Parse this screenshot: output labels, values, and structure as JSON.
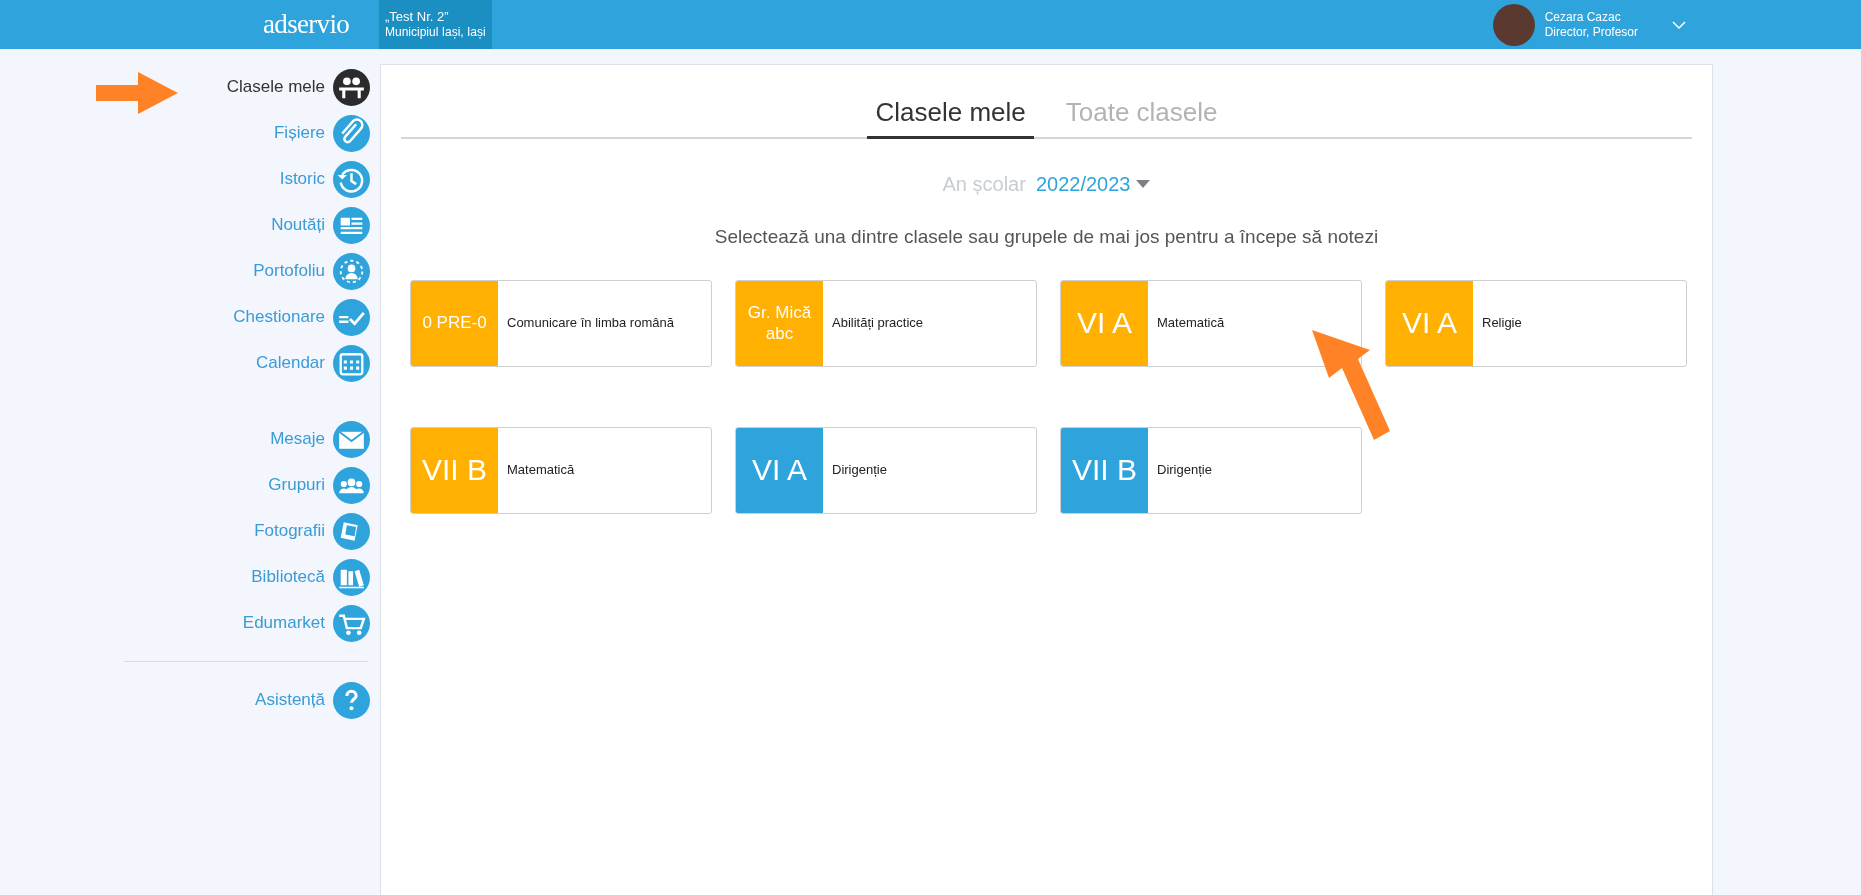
{
  "header": {
    "logo": "adservio",
    "school": {
      "name": "„Test Nr. 2”",
      "location": "Municipiul Iași, Iași"
    },
    "user": {
      "name": "Cezara Cazac",
      "role": "Director, Profesor"
    }
  },
  "sidebar": {
    "groups": [
      [
        {
          "label": "Clasele mele",
          "kind": "classes",
          "selected": true
        },
        {
          "label": "Fișiere",
          "kind": "clip",
          "selected": false
        },
        {
          "label": "Istoric",
          "kind": "history",
          "selected": false
        },
        {
          "label": "Noutăți",
          "kind": "news",
          "selected": false
        },
        {
          "label": "Portofoliu",
          "kind": "portfolio",
          "selected": false
        },
        {
          "label": "Chestionare",
          "kind": "quiz",
          "selected": false
        },
        {
          "label": "Calendar",
          "kind": "calendar",
          "selected": false
        }
      ],
      [
        {
          "label": "Mesaje",
          "kind": "mail",
          "selected": false
        },
        {
          "label": "Grupuri",
          "kind": "groups",
          "selected": false
        },
        {
          "label": "Fotografii",
          "kind": "photos",
          "selected": false
        },
        {
          "label": "Bibliotecă",
          "kind": "library",
          "selected": false
        },
        {
          "label": "Edumarket",
          "kind": "cart",
          "selected": false
        }
      ],
      [
        {
          "label": "Asistență",
          "kind": "help",
          "selected": false
        }
      ]
    ]
  },
  "tabs": [
    {
      "label": "Clasele mele",
      "selected": true
    },
    {
      "label": "Toate clasele",
      "selected": false
    }
  ],
  "school_year": {
    "label": "An școlar",
    "value": "2022/2023"
  },
  "instruction": "Selectează una dintre clasele sau grupele de mai jos pentru a începe să notezi",
  "classes": [
    {
      "class": "0 PRE-0",
      "subject": "Comunicare în limba română",
      "color": "#ffb000"
    },
    {
      "class": "Gr. Mică abc",
      "subject": "Abilități practice",
      "color": "#ffb000"
    },
    {
      "class": "VI A",
      "subject": "Matematică",
      "color": "#ffb000"
    },
    {
      "class": "VI A",
      "subject": "Religie",
      "color": "#ffb000"
    },
    {
      "class": "VII B",
      "subject": "Matematică",
      "color": "#ffb000"
    },
    {
      "class": "VI A",
      "subject": "Dirigenție",
      "color": "#2fa4dc"
    },
    {
      "class": "VII B",
      "subject": "Dirigenție",
      "color": "#2fa4dc"
    }
  ]
}
